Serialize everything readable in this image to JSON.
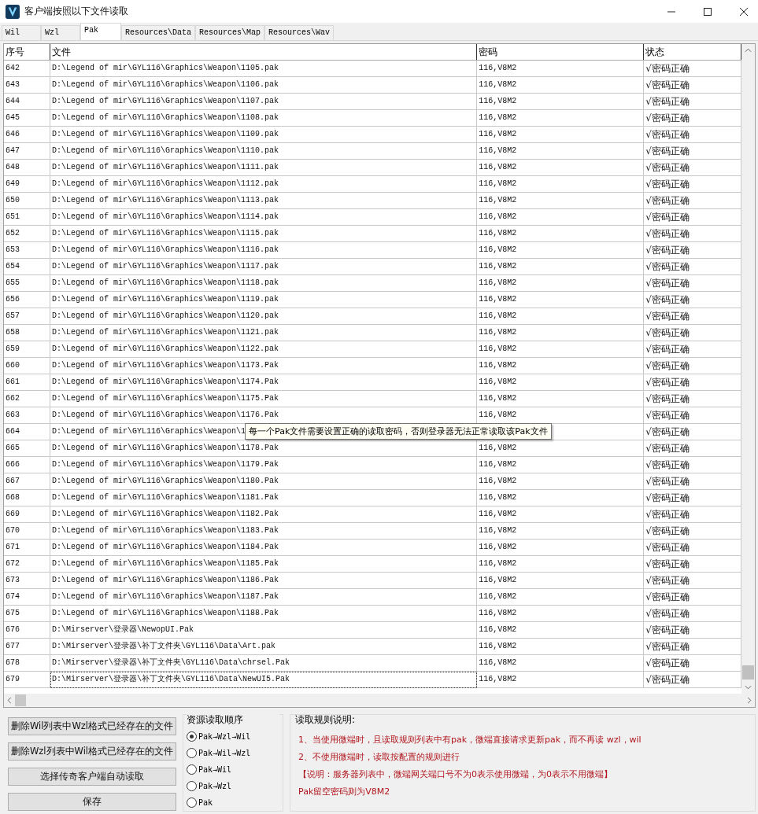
{
  "window": {
    "title": "客户端按照以下文件读取"
  },
  "tabs": [
    {
      "label": "Wil",
      "selected": false
    },
    {
      "label": "Wzl",
      "selected": false
    },
    {
      "label": "Pak",
      "selected": true
    },
    {
      "label": "Resources\\Data",
      "selected": false
    },
    {
      "label": "Resources\\Map",
      "selected": false
    },
    {
      "label": "Resources\\Wav",
      "selected": false
    }
  ],
  "table": {
    "columns": [
      "序号",
      "文件",
      "密码",
      "状态"
    ],
    "rows": [
      {
        "no": "642",
        "file": "D:\\Legend of mir\\GYL116\\Graphics\\Weapon\\1105.pak",
        "password": "116,V8M2",
        "status": "√密码正确",
        "selected": false
      },
      {
        "no": "643",
        "file": "D:\\Legend of mir\\GYL116\\Graphics\\Weapon\\1106.pak",
        "password": "116,V8M2",
        "status": "√密码正确",
        "selected": false
      },
      {
        "no": "644",
        "file": "D:\\Legend of mir\\GYL116\\Graphics\\Weapon\\1107.pak",
        "password": "116,V8M2",
        "status": "√密码正确",
        "selected": false
      },
      {
        "no": "645",
        "file": "D:\\Legend of mir\\GYL116\\Graphics\\Weapon\\1108.pak",
        "password": "116,V8M2",
        "status": "√密码正确",
        "selected": false
      },
      {
        "no": "646",
        "file": "D:\\Legend of mir\\GYL116\\Graphics\\Weapon\\1109.pak",
        "password": "116,V8M2",
        "status": "√密码正确",
        "selected": false
      },
      {
        "no": "647",
        "file": "D:\\Legend of mir\\GYL116\\Graphics\\Weapon\\1110.pak",
        "password": "116,V8M2",
        "status": "√密码正确",
        "selected": false
      },
      {
        "no": "648",
        "file": "D:\\Legend of mir\\GYL116\\Graphics\\Weapon\\1111.pak",
        "password": "116,V8M2",
        "status": "√密码正确",
        "selected": false
      },
      {
        "no": "649",
        "file": "D:\\Legend of mir\\GYL116\\Graphics\\Weapon\\1112.pak",
        "password": "116,V8M2",
        "status": "√密码正确",
        "selected": false
      },
      {
        "no": "650",
        "file": "D:\\Legend of mir\\GYL116\\Graphics\\Weapon\\1113.pak",
        "password": "116,V8M2",
        "status": "√密码正确",
        "selected": false
      },
      {
        "no": "651",
        "file": "D:\\Legend of mir\\GYL116\\Graphics\\Weapon\\1114.pak",
        "password": "116,V8M2",
        "status": "√密码正确",
        "selected": false
      },
      {
        "no": "652",
        "file": "D:\\Legend of mir\\GYL116\\Graphics\\Weapon\\1115.pak",
        "password": "116,V8M2",
        "status": "√密码正确",
        "selected": false
      },
      {
        "no": "653",
        "file": "D:\\Legend of mir\\GYL116\\Graphics\\Weapon\\1116.pak",
        "password": "116,V8M2",
        "status": "√密码正确",
        "selected": false
      },
      {
        "no": "654",
        "file": "D:\\Legend of mir\\GYL116\\Graphics\\Weapon\\1117.pak",
        "password": "116,V8M2",
        "status": "√密码正确",
        "selected": false
      },
      {
        "no": "655",
        "file": "D:\\Legend of mir\\GYL116\\Graphics\\Weapon\\1118.pak",
        "password": "116,V8M2",
        "status": "√密码正确",
        "selected": false
      },
      {
        "no": "656",
        "file": "D:\\Legend of mir\\GYL116\\Graphics\\Weapon\\1119.pak",
        "password": "116,V8M2",
        "status": "√密码正确",
        "selected": false
      },
      {
        "no": "657",
        "file": "D:\\Legend of mir\\GYL116\\Graphics\\Weapon\\1120.pak",
        "password": "116,V8M2",
        "status": "√密码正确",
        "selected": false
      },
      {
        "no": "658",
        "file": "D:\\Legend of mir\\GYL116\\Graphics\\Weapon\\1121.pak",
        "password": "116,V8M2",
        "status": "√密码正确",
        "selected": false
      },
      {
        "no": "659",
        "file": "D:\\Legend of mir\\GYL116\\Graphics\\Weapon\\1122.pak",
        "password": "116,V8M2",
        "status": "√密码正确",
        "selected": false
      },
      {
        "no": "660",
        "file": "D:\\Legend of mir\\GYL116\\Graphics\\Weapon\\1173.Pak",
        "password": "116,V8M2",
        "status": "√密码正确",
        "selected": false
      },
      {
        "no": "661",
        "file": "D:\\Legend of mir\\GYL116\\Graphics\\Weapon\\1174.Pak",
        "password": "116,V8M2",
        "status": "√密码正确",
        "selected": false
      },
      {
        "no": "662",
        "file": "D:\\Legend of mir\\GYL116\\Graphics\\Weapon\\1175.Pak",
        "password": "116,V8M2",
        "status": "√密码正确",
        "selected": false
      },
      {
        "no": "663",
        "file": "D:\\Legend of mir\\GYL116\\Graphics\\Weapon\\1176.Pak",
        "password": "116,V8M2",
        "status": "√密码正确",
        "selected": false
      },
      {
        "no": "664",
        "file": "D:\\Legend of mir\\GYL116\\Graphics\\Weapon\\1",
        "status": "√密码正确",
        "selected": false
      },
      {
        "no": "665",
        "file": "D:\\Legend of mir\\GYL116\\Graphics\\Weapon\\1178.Pak",
        "password": "116,V8M2",
        "status": "√密码正确",
        "selected": false
      },
      {
        "no": "666",
        "file": "D:\\Legend of mir\\GYL116\\Graphics\\Weapon\\1179.Pak",
        "password": "116,V8M2",
        "status": "√密码正确",
        "selected": false
      },
      {
        "no": "667",
        "file": "D:\\Legend of mir\\GYL116\\Graphics\\Weapon\\1180.Pak",
        "password": "116,V8M2",
        "status": "√密码正确",
        "selected": false
      },
      {
        "no": "668",
        "file": "D:\\Legend of mir\\GYL116\\Graphics\\Weapon\\1181.Pak",
        "password": "116,V8M2",
        "status": "√密码正确",
        "selected": false
      },
      {
        "no": "669",
        "file": "D:\\Legend of mir\\GYL116\\Graphics\\Weapon\\1182.Pak",
        "password": "116,V8M2",
        "status": "√密码正确",
        "selected": false
      },
      {
        "no": "670",
        "file": "D:\\Legend of mir\\GYL116\\Graphics\\Weapon\\1183.Pak",
        "password": "116,V8M2",
        "status": "√密码正确",
        "selected": false
      },
      {
        "no": "671",
        "file": "D:\\Legend of mir\\GYL116\\Graphics\\Weapon\\1184.Pak",
        "password": "116,V8M2",
        "status": "√密码正确",
        "selected": false
      },
      {
        "no": "672",
        "file": "D:\\Legend of mir\\GYL116\\Graphics\\Weapon\\1185.Pak",
        "password": "116,V8M2",
        "status": "√密码正确",
        "selected": false
      },
      {
        "no": "673",
        "file": "D:\\Legend of mir\\GYL116\\Graphics\\Weapon\\1186.Pak",
        "password": "116,V8M2",
        "status": "√密码正确",
        "selected": false
      },
      {
        "no": "674",
        "file": "D:\\Legend of mir\\GYL116\\Graphics\\Weapon\\1187.Pak",
        "password": "116,V8M2",
        "status": "√密码正确",
        "selected": false
      },
      {
        "no": "675",
        "file": "D:\\Legend of mir\\GYL116\\Graphics\\Weapon\\1188.Pak",
        "password": "116,V8M2",
        "status": "√密码正确",
        "selected": false
      },
      {
        "no": "676",
        "file": "D:\\Mirserver\\登录器\\NewopUI.Pak",
        "password": "116,V8M2",
        "status": "√密码正确",
        "selected": false
      },
      {
        "no": "677",
        "file": "D:\\Mirserver\\登录器\\补丁文件夹\\GYL116\\Data\\Art.pak",
        "password": "116,V8M2",
        "status": "√密码正确",
        "selected": false
      },
      {
        "no": "678",
        "file": "D:\\Mirserver\\登录器\\补丁文件夹\\GYL116\\Data\\chrsel.Pak",
        "password": "116,V8M2",
        "status": "√密码正确",
        "selected": false
      },
      {
        "no": "679",
        "file": "D:\\Mirserver\\登录器\\补丁文件夹\\GYL116\\Data\\NewUI5.Pak",
        "password": "116,V8M2",
        "status": "√密码正确",
        "selected": true
      }
    ]
  },
  "tooltip": "每一个Pak文件需要设置正确的读取密码，否则登录器无法正常读取该Pak文件",
  "buttons": [
    "删除Wil列表中Wzl格式已经存在的文件",
    "删除Wzl列表中Wil格式已经存在的文件",
    "选择传奇客户端自动读取",
    "保存"
  ],
  "order": {
    "title": "资源读取顺序",
    "options": [
      {
        "label": "Pak→Wzl→Wil",
        "selected": true
      },
      {
        "label": "Pak→Wil→Wzl",
        "selected": false
      },
      {
        "label": "Pak→Wil",
        "selected": false
      },
      {
        "label": "Pak→Wzl",
        "selected": false
      },
      {
        "label": "Pak",
        "selected": false
      }
    ]
  },
  "rules": {
    "title": "读取规则说明:",
    "lines": [
      "1、当使用微端时，且读取规则列表中有pak，微端直接请求更新pak，而不再读 wzl，wil",
      "2、不使用微端时，读取按配置的规则进行",
      "【说明：服务器列表中，微端网关端口号不为0表示使用微端，为0表示不用微端】",
      "Pak留空密码则为V8M2"
    ]
  }
}
